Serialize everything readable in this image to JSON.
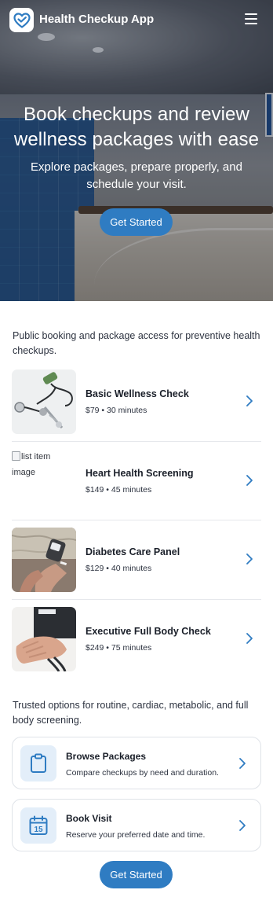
{
  "header": {
    "app_name": "Health Checkup App"
  },
  "hero": {
    "title": "Book checkups and review wellness packages with ease",
    "subtitle": "Explore packages, prepare properly, and schedule your visit.",
    "cta_label": "Get Started"
  },
  "intro_text": "Public booking and package access for preventive health checkups.",
  "packages": [
    {
      "name": "Basic Wellness Check",
      "meta": "$79 • 30 minutes",
      "image": "stethoscope-reflex-hammer-photo"
    },
    {
      "name": "Heart Health Screening",
      "meta": "$149 • 45 minutes",
      "image_alt": "list item image"
    },
    {
      "name": "Diabetes Care Panel",
      "meta": "$129 • 40 minutes",
      "image": "glucose-meter-finger-test-photo"
    },
    {
      "name": "Executive Full Body Check",
      "meta": "$249 • 75 minutes",
      "image": "blood-pressure-cuff-photo"
    }
  ],
  "trust_text": "Trusted options for routine, cardiac, metabolic, and full body screening.",
  "cards": {
    "browse": {
      "title": "Browse Packages",
      "description": "Compare checkups by need and duration.",
      "icon": "clipboard-icon"
    },
    "visit": {
      "title": "Book Visit",
      "description": "Reserve your preferred date and time.",
      "icon": "calendar-icon",
      "icon_day": "15"
    }
  },
  "footer": {
    "cta_label": "Get Started"
  },
  "colors": {
    "accent": "#2f7cc2",
    "icon_tile": "#e3eef9",
    "text": "#1f2430"
  }
}
